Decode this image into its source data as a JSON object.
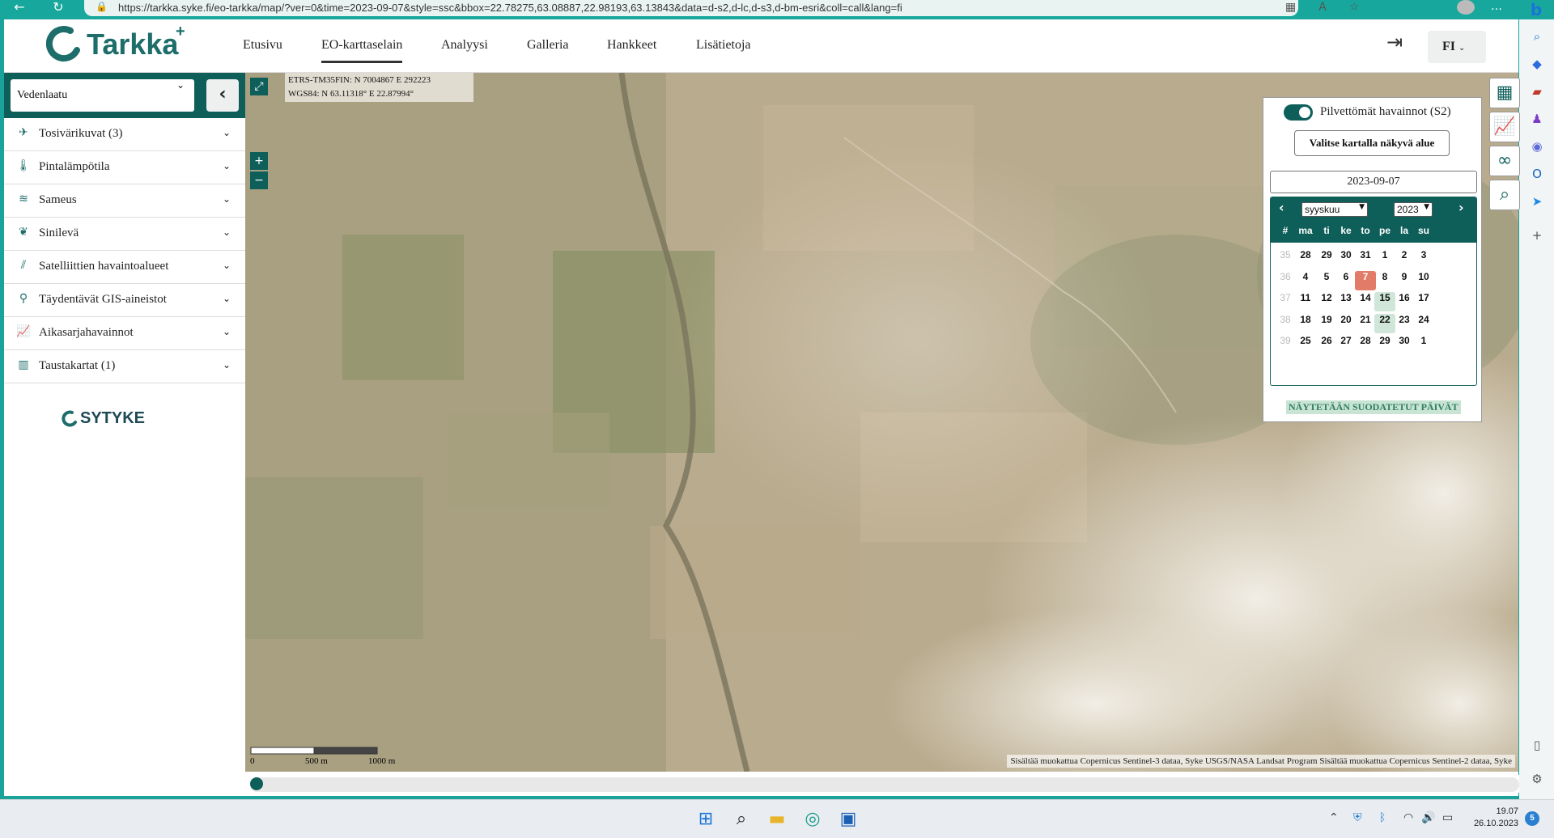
{
  "browser": {
    "url": "https://tarkka.syke.fi/eo-tarkka/map/?ver=0&time=2023-09-07&style=ssc&bbox=22.78275,63.08887,22.98193,63.13843&data=d-s2,d-lc,d-s3,d-bm-esri&coll=call&lang=fi"
  },
  "app": {
    "logo_text": "Tarkka",
    "logo_plus": "+",
    "nav": [
      "Etusivu",
      "EO-karttaselain",
      "Analyysi",
      "Galleria",
      "Hankkeet",
      "Lisätietoja"
    ],
    "active_nav": "EO-karttaselain",
    "language": "FI"
  },
  "sidebar": {
    "theme_select": "Vedenlaatu",
    "layers": [
      {
        "label": "Tosivärikuvat (3)",
        "icon": "satellite-icon"
      },
      {
        "label": "Pintalämpötila",
        "icon": "thermometer-icon"
      },
      {
        "label": "Sameus",
        "icon": "waves-icon"
      },
      {
        "label": "Sinilevä",
        "icon": "algae-icon"
      },
      {
        "label": "Satelliittien havaintoalueet",
        "icon": "stripes-icon"
      },
      {
        "label": "Täydentävät GIS-aineistot",
        "icon": "gis-icon"
      },
      {
        "label": "Aikasarjahavainnot",
        "icon": "chart-icon"
      },
      {
        "label": "Taustakartat (1)",
        "icon": "map-icon"
      }
    ],
    "footer_logo": "SYTYKE"
  },
  "map": {
    "coords_tm35": "ETRS-TM35FIN: N 7004867 E 292223",
    "coords_wgs84": "WGS84: N 63.11318° E 22.87994°",
    "scale_labels": [
      "0",
      "500 m",
      "1000 m"
    ],
    "attribution": "Sisältää muokattua Copernicus Sentinel-3 dataa, Syke USGS/NASA Landsat Program Sisältää muokattua Copernicus Sentinel-2 dataa, Syke"
  },
  "calendar": {
    "toggle_label": "Pilvettömät havainnot (S2)",
    "area_button": "Valitse kartalla näkyvä alue",
    "selected_date": "2023-09-07",
    "month": "syyskuu",
    "year": "2023",
    "weekdays": [
      "#",
      "ma",
      "ti",
      "ke",
      "to",
      "pe",
      "la",
      "su"
    ],
    "weeks": [
      {
        "week": "35",
        "days": [
          "28",
          "29",
          "30",
          "31",
          "1",
          "2",
          "3"
        ]
      },
      {
        "week": "36",
        "days": [
          "4",
          "5",
          "6",
          "7",
          "8",
          "9",
          "10"
        ]
      },
      {
        "week": "37",
        "days": [
          "11",
          "12",
          "13",
          "14",
          "15",
          "16",
          "17"
        ]
      },
      {
        "week": "38",
        "days": [
          "18",
          "19",
          "20",
          "21",
          "22",
          "23",
          "24"
        ]
      },
      {
        "week": "39",
        "days": [
          "25",
          "26",
          "27",
          "28",
          "29",
          "30",
          "1"
        ]
      }
    ],
    "highlight_selected": "7",
    "observation_days": [
      "15",
      "22"
    ],
    "filter_label": "NÄYTETÄÄN SUODATETUT PÄIVÄT"
  },
  "taskbar": {
    "time": "19.07",
    "date": "26.10.2023",
    "notifications": "5"
  },
  "colors": {
    "brand": "#0e5f5a",
    "selected_day": "#e27b67",
    "observation_day": "#cfe6d8",
    "browser_bar": "#18a79c"
  }
}
